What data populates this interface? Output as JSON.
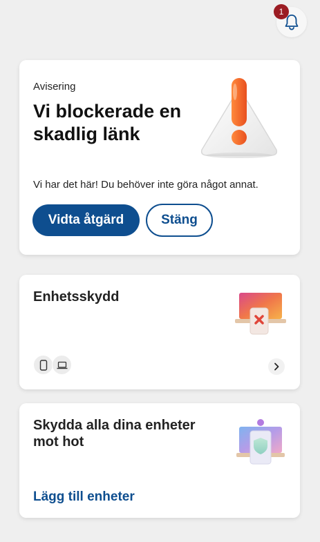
{
  "header": {
    "notification_count": "1",
    "bell_icon": "bell-icon"
  },
  "alert_card": {
    "eyebrow": "Avisering",
    "title": "Vi blockerade en skadlig länk",
    "body": "Vi har det här! Du behöver inte göra något annat.",
    "primary_button": "Vidta åtgärd",
    "secondary_button": "Stäng",
    "illustration": "warning-triangle-icon"
  },
  "device_card": {
    "title": "Enhetsskydd",
    "icons": [
      "phone-icon",
      "laptop-icon"
    ],
    "chevron": "chevron-right-icon",
    "illustration": "blocked-device-illustration"
  },
  "protect_card": {
    "title": "Skydda alla dina enheter mot hot",
    "link": "Lägg till enheter",
    "illustration": "protected-devices-illustration"
  },
  "colors": {
    "accent": "#0e4e8f",
    "badge": "#9b1c23",
    "background": "#efefef",
    "warning": "#f2652a"
  }
}
